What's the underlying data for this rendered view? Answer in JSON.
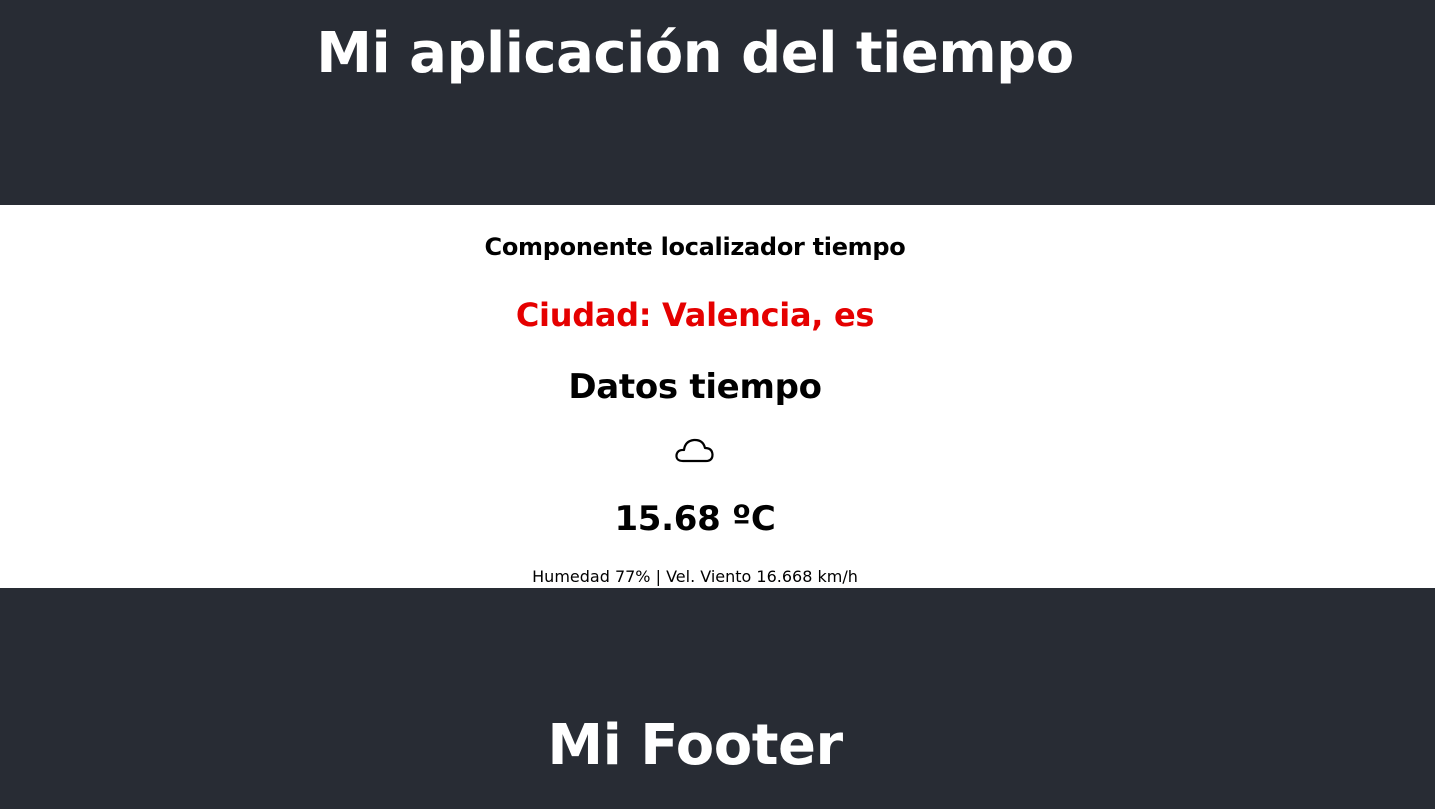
{
  "header": {
    "title": "Mi aplicación del tiempo"
  },
  "weather": {
    "component_title": "Componente localizador tiempo",
    "city": "Ciudad: Valencia, es",
    "section_title": "Datos tiempo",
    "icon": "cloud-icon",
    "temperature": "15.68 ºC",
    "details": "Humedad 77% | Vel. Viento 16.668 km/h"
  },
  "footer": {
    "title": "Mi Footer"
  },
  "colors": {
    "bar_background": "#282c34",
    "city_text": "#e50000",
    "bar_text": "#ffffff"
  }
}
